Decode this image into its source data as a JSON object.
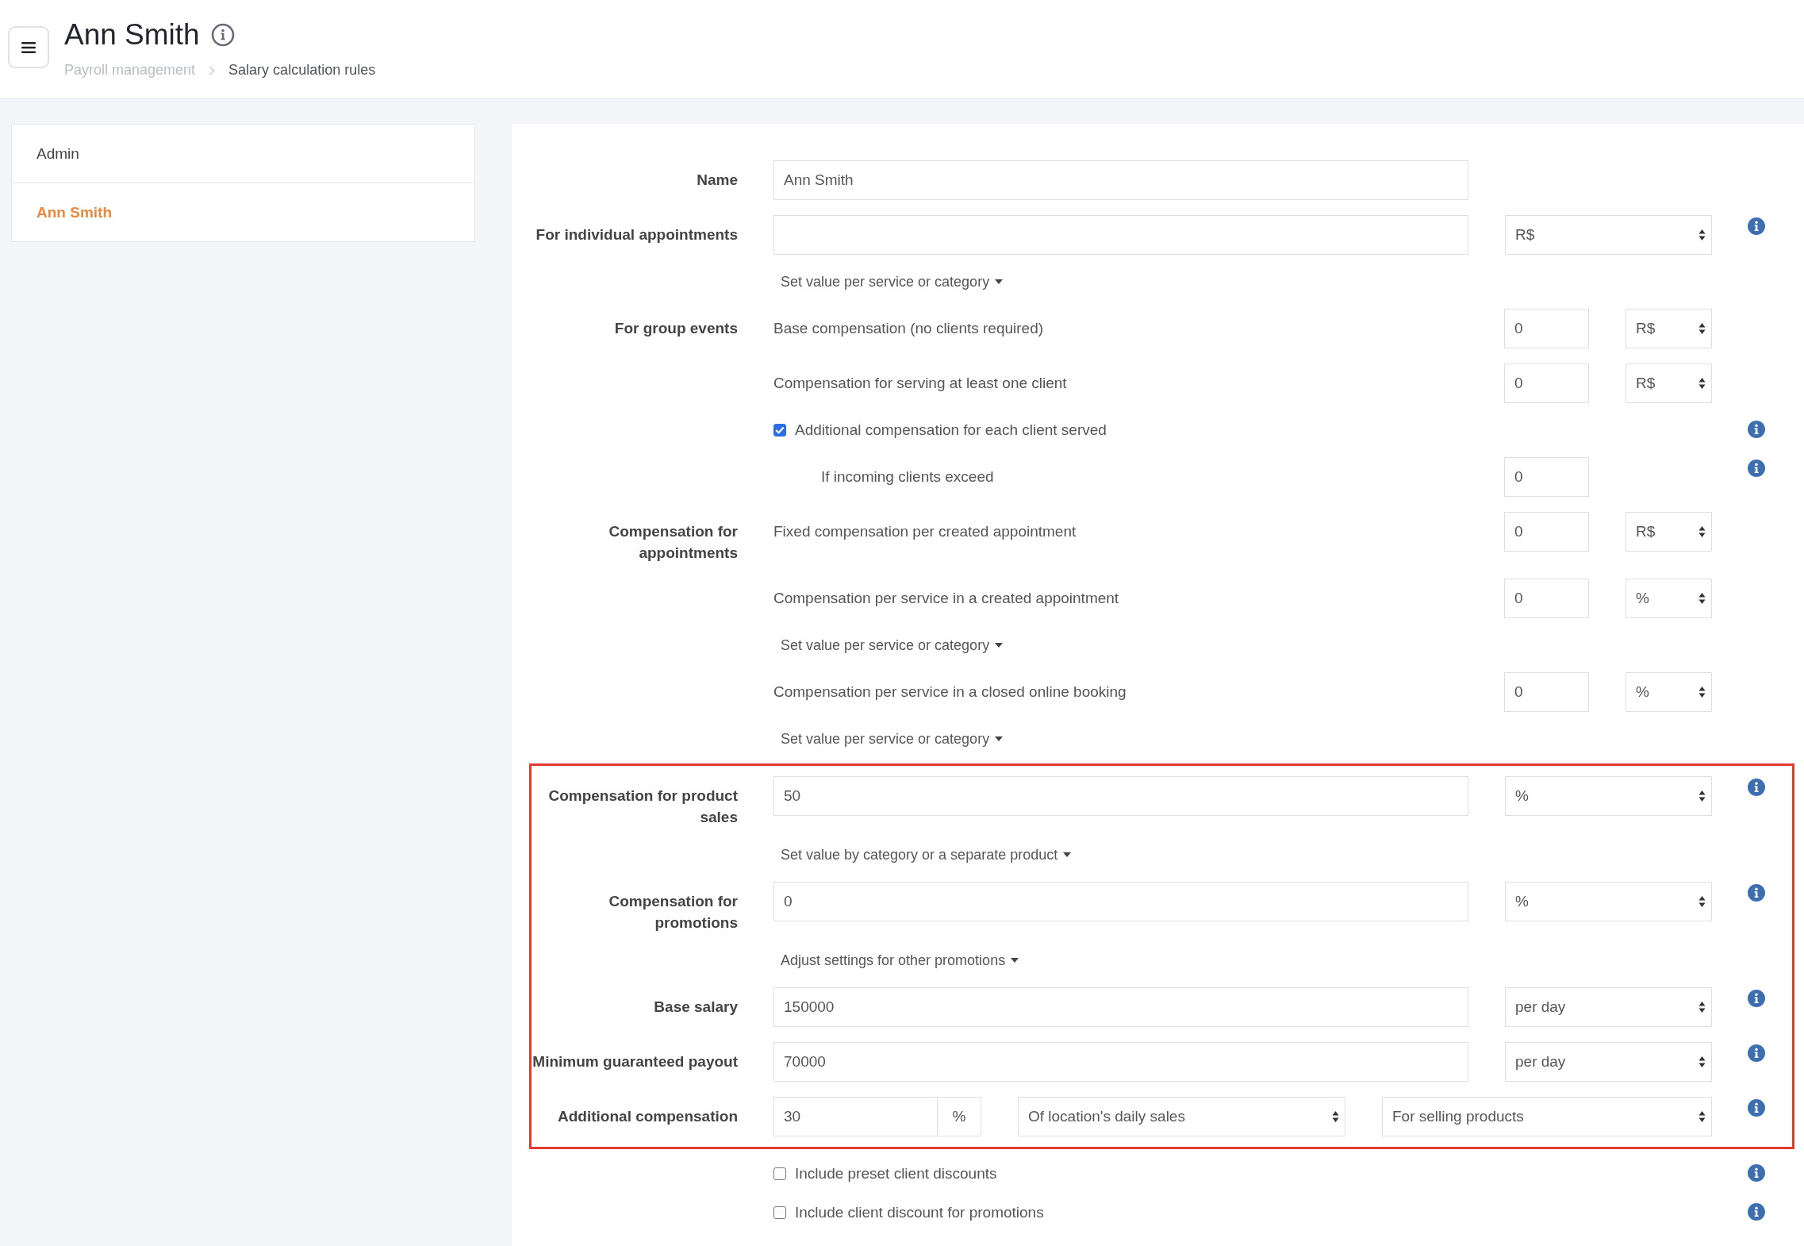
{
  "header": {
    "title": "Ann Smith",
    "breadcrumbs": [
      "Payroll management",
      "Salary calculation rules"
    ]
  },
  "sidebar": {
    "items": [
      {
        "label": "Admin",
        "selected": false
      },
      {
        "label": "Ann Smith",
        "selected": true
      }
    ]
  },
  "form": {
    "sections": [
      {
        "highlighted": false,
        "rows": [
          {
            "kind": "field",
            "label": "Name",
            "value": "Ann Smith",
            "info": false
          },
          {
            "kind": "field",
            "label": "For individual appointments",
            "unit": "R$",
            "info": true
          },
          {
            "kind": "link",
            "text": "Set value per service or category"
          },
          {
            "kind": "line",
            "label": "For group events",
            "text": "Base compensation (no clients required)",
            "value": "0",
            "unit": "R$",
            "info": false
          },
          {
            "kind": "line",
            "text": "Compensation for serving at least one client",
            "value": "0",
            "unit": "R$",
            "info": false
          },
          {
            "kind": "checkbox",
            "text": "Additional compensation for each client served",
            "checked": true,
            "info": true
          },
          {
            "kind": "subline",
            "text": "If incoming clients exceed",
            "value": "0",
            "info": true
          },
          {
            "kind": "line",
            "label": "Compensation for appointments",
            "text": "Fixed compensation per created appointment",
            "value": "0",
            "unit": "R$",
            "info": false
          },
          {
            "kind": "line",
            "text": "Compensation per service in a created appointment",
            "value": "0",
            "unit": "%",
            "info": false
          },
          {
            "kind": "link",
            "text": "Set value per service or category"
          },
          {
            "kind": "line",
            "text": "Compensation per service in a closed online booking",
            "value": "0",
            "unit": "%",
            "info": false
          },
          {
            "kind": "link",
            "text": "Set value per service or category"
          }
        ]
      },
      {
        "highlighted": true,
        "rows": [
          {
            "kind": "field",
            "label": "Compensation for product sales",
            "value": "50",
            "unit": "%",
            "info": true
          },
          {
            "kind": "link",
            "text": "Set value by category or a separate product"
          },
          {
            "kind": "field",
            "label": "Compensation for promotions",
            "value": "0",
            "unit": "%",
            "info": true
          },
          {
            "kind": "link",
            "text": "Adjust settings for other promotions"
          },
          {
            "kind": "field",
            "label": "Base salary",
            "value": "150000",
            "unit": "per day",
            "info": true
          },
          {
            "kind": "field",
            "label": "Minimum guaranteed payout",
            "value": "70000",
            "unit": "per day",
            "info": true
          },
          {
            "kind": "combo",
            "label": "Additional compensation",
            "value": "30",
            "suffix": "%",
            "selects": [
              "Of location's daily sales",
              "For selling products"
            ],
            "info": true
          }
        ]
      },
      {
        "highlighted": false,
        "rows": [
          {
            "kind": "checkbox",
            "text": "Include preset client discounts",
            "checked": false,
            "info": true
          },
          {
            "kind": "checkbox",
            "text": "Include client discount for promotions",
            "checked": false,
            "info": true
          }
        ]
      }
    ]
  }
}
